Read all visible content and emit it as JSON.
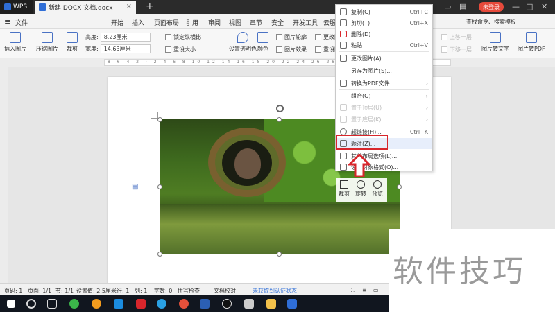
{
  "titlebar": {
    "app_name": "WPS",
    "doc_tab_title": "新建 DOCX 文档.docx",
    "close_glyph": "×",
    "new_tab_glyph": "+",
    "login_label": "未登录"
  },
  "menubar": {
    "file_label": "文件",
    "items": [
      "开始",
      "插入",
      "页面布局",
      "引用",
      "审阅",
      "视图",
      "章节",
      "安全",
      "开发工具",
      "云服"
    ],
    "search_label": "查找命令、搜索模板"
  },
  "ribbon": {
    "insert_picture": "插入图片",
    "compress_picture": "压缩图片",
    "crop": "裁剪",
    "height_label": "高度:",
    "height_value": "8.23厘米",
    "width_label": "宽度:",
    "width_value": "14.63厘米",
    "lock_ratio": "锁定纵横比",
    "reset_size": "重设大小",
    "set_transparent": "设置透明色",
    "color": "颜色",
    "picture_outline": "图片轮廓",
    "picture_effect": "图片效果",
    "change_picture": "更改图",
    "reset_picture": "重设图",
    "bring_forward": "上移一层",
    "send_backward": "下移一层",
    "picture_to_text": "图片转文字",
    "picture_to_pdf": "图片转PDF"
  },
  "context_menu": {
    "items": [
      {
        "label": "复制(C)",
        "shortcut": "Ctrl+C",
        "enabled": true
      },
      {
        "label": "剪切(T)",
        "shortcut": "Ctrl+X",
        "enabled": true
      },
      {
        "label": "删除(D)",
        "shortcut": "",
        "enabled": true
      },
      {
        "label": "粘贴",
        "shortcut": "Ctrl+V",
        "enabled": true
      },
      {
        "label": "更改图片(A)...",
        "shortcut": "",
        "enabled": true
      },
      {
        "label": "另存为图片(S)...",
        "shortcut": "",
        "enabled": true
      },
      {
        "label": "转换为PDF文件",
        "shortcut": "",
        "enabled": true,
        "submenu": true
      },
      {
        "label": "组合(G)",
        "shortcut": "",
        "enabled": true,
        "submenu": true
      },
      {
        "label": "置于顶层(U)",
        "shortcut": "",
        "enabled": false,
        "submenu": true
      },
      {
        "label": "置于底层(K)",
        "shortcut": "",
        "enabled": false,
        "submenu": true
      },
      {
        "label": "超链接(H)...",
        "shortcut": "Ctrl+K",
        "enabled": true
      },
      {
        "label": "题注(Z)...",
        "shortcut": "",
        "enabled": true,
        "highlighted": true
      },
      {
        "label": "其他布局选项(L)...",
        "shortcut": "",
        "enabled": true
      },
      {
        "label": "设置对象格式(O)...",
        "shortcut": "",
        "enabled": true
      }
    ]
  },
  "float_toolbar": {
    "crop": "裁剪",
    "rotate": "旋转",
    "preview": "预览"
  },
  "statusbar": {
    "page_code": "页码: 1",
    "page": "页面: 1/1",
    "section": "节: 1/1",
    "setting": "设置值: 2.5厘米",
    "row": "行: 1",
    "col": "列: 1",
    "word_count": "字数: 0",
    "spell_check": "拼写检查",
    "doc_proof": "文档校对",
    "auth_status": "未获取到认证状态"
  },
  "watermark": "软件技巧",
  "colors": {
    "accent": "#2f6ed7",
    "highlight_box": "#d8262c",
    "login_button": "#e74a3b"
  }
}
